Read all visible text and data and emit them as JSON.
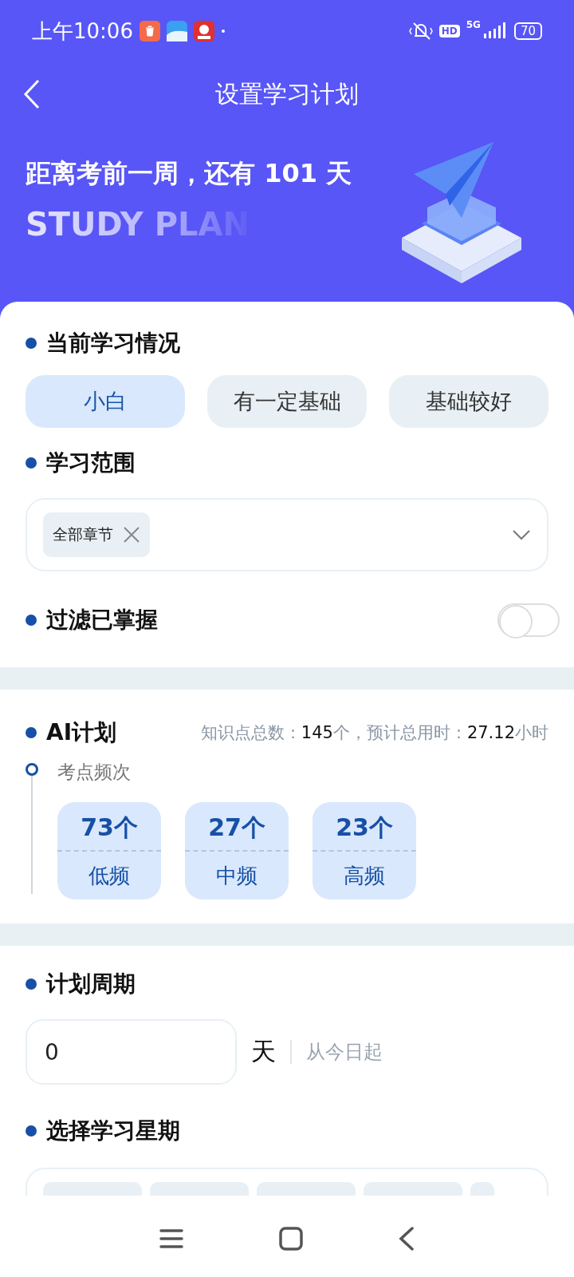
{
  "status_bar": {
    "time": "上午10:06",
    "hd": "HD",
    "network": "5G",
    "battery": "70"
  },
  "header": {
    "title": "设置学习计划"
  },
  "hero": {
    "headline": "距离考前一周，还有 101 天",
    "subtitle": "STUDY PLAN"
  },
  "level": {
    "title": "当前学习情况",
    "options": [
      {
        "label": "小白",
        "selected": true
      },
      {
        "label": "有一定基础",
        "selected": false
      },
      {
        "label": "基础较好",
        "selected": false
      }
    ]
  },
  "scope": {
    "title": "学习范围",
    "tags": [
      {
        "label": "全部章节"
      }
    ]
  },
  "filter": {
    "title": "过滤已掌握",
    "on": false
  },
  "ai_plan": {
    "title": "AI计划",
    "summary": [
      {
        "text": "知识点总数：",
        "kind": "label"
      },
      {
        "text": "145",
        "kind": "value"
      },
      {
        "text": "个，预计总用时：",
        "kind": "label"
      },
      {
        "text": "27.12",
        "kind": "value"
      },
      {
        "text": "小时",
        "kind": "label"
      }
    ],
    "frequency_title": "考点频次",
    "frequency": [
      {
        "count": "73个",
        "label": "低频"
      },
      {
        "count": "27个",
        "label": "中频"
      },
      {
        "count": "23个",
        "label": "高频"
      }
    ]
  },
  "period": {
    "title": "计划周期",
    "value": "0",
    "unit": "天",
    "hint": "从今日起"
  },
  "weekdays": {
    "title": "选择学习星期"
  }
}
